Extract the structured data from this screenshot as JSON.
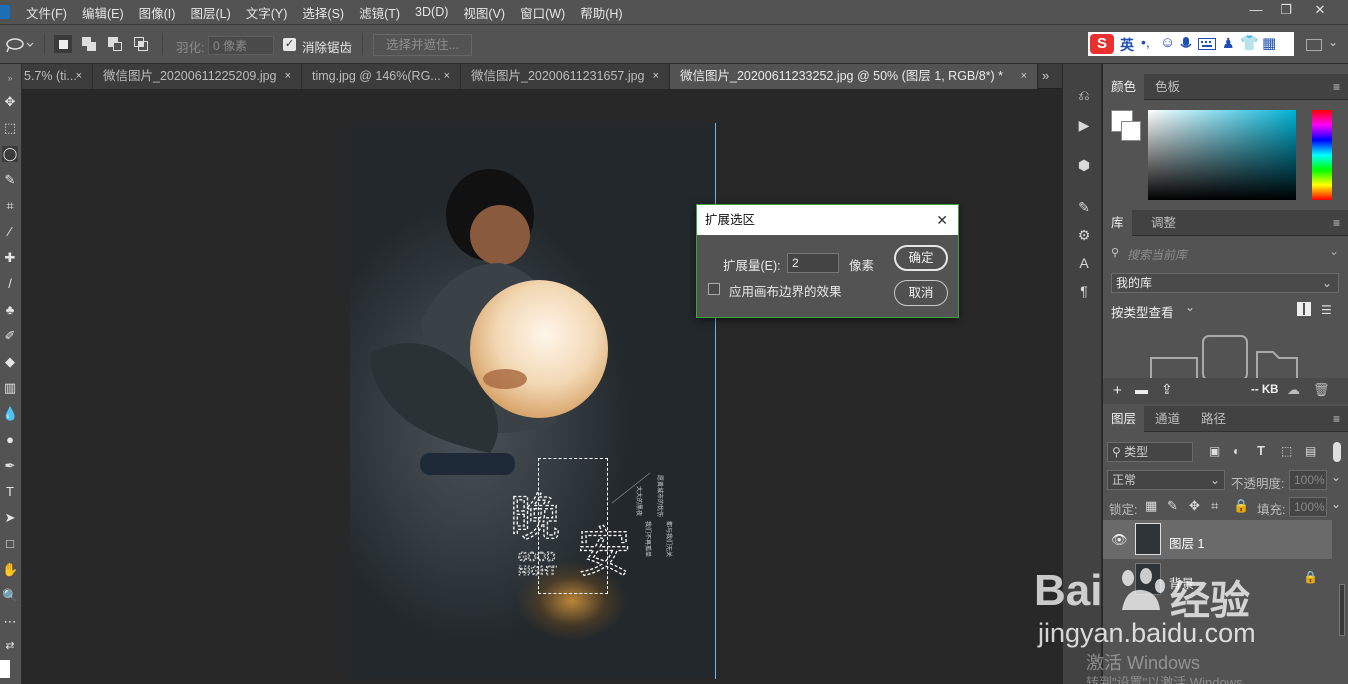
{
  "menubar": {
    "items": [
      "文件(F)",
      "编辑(E)",
      "图像(I)",
      "图层(L)",
      "文字(Y)",
      "选择(S)",
      "滤镜(T)",
      "3D(D)",
      "视图(V)",
      "窗口(W)",
      "帮助(H)"
    ]
  },
  "options": {
    "feather_label": "羽化:",
    "feather_placeholder": "0 像素",
    "antialias_label": "消除锯齿",
    "select_mask_label": "选择并遮住..."
  },
  "ime": {
    "lang_label": "英"
  },
  "tabs": [
    {
      "label": "5.7% (ti...",
      "close": "×"
    },
    {
      "label": "微信图片_20200611225209.jpg",
      "close": "×"
    },
    {
      "label": "timg.jpg @ 146%(RG...",
      "close": "×"
    },
    {
      "label": "微信图片_20200611231657.jpg",
      "close": "×"
    },
    {
      "label": "微信图片_20200611233252.jpg @ 50% (图层 1, RGB/8*) *",
      "close": "×"
    }
  ],
  "tab_overflow": "»",
  "artwork": {
    "title_char1": "晚",
    "title_char2": "安",
    "good": "GOOD",
    "night": "NIGHT",
    "caption1": "大大的黑夜",
    "caption2": "我们不再孤单",
    "caption3": "愿黄城市的忧伤",
    "caption4": "都与我们无关"
  },
  "dialog": {
    "title": "扩展选区",
    "expand_label": "扩展量(E):",
    "expand_value": "2",
    "unit": "像素",
    "ok": "确定",
    "cancel": "取消",
    "canvas_bounds_label": "应用画布边界的效果"
  },
  "color_panel": {
    "tabs": [
      "颜色",
      "色板"
    ]
  },
  "library_panel": {
    "tabs": [
      "库",
      "调整"
    ],
    "search_placeholder": "搜索当前库",
    "library_name": "我的库",
    "view_by": "按类型查看",
    "size": "-- KB"
  },
  "layers_panel": {
    "tabs": [
      "图层",
      "通道",
      "路径"
    ],
    "kind_label": "类型",
    "blend_mode": "正常",
    "opacity_label": "不透明度:",
    "opacity_value": "100%",
    "lock_label": "锁定:",
    "fill_label": "填充:",
    "fill_value": "100%",
    "layers": [
      {
        "name": "图层 1"
      },
      {
        "name": "背景"
      }
    ]
  },
  "watermark": {
    "baidu": "Bai",
    "jingyan": "经验",
    "url": "jingyan.baidu.com"
  },
  "activation": {
    "line1": "激活 Windows",
    "line2": "转到\"设置\"以激活 Windows"
  },
  "colors": {
    "menubar": "#535353",
    "canvas": "#282828",
    "dialog_border": "#3aa33a",
    "ime_red": "#e8312f"
  }
}
